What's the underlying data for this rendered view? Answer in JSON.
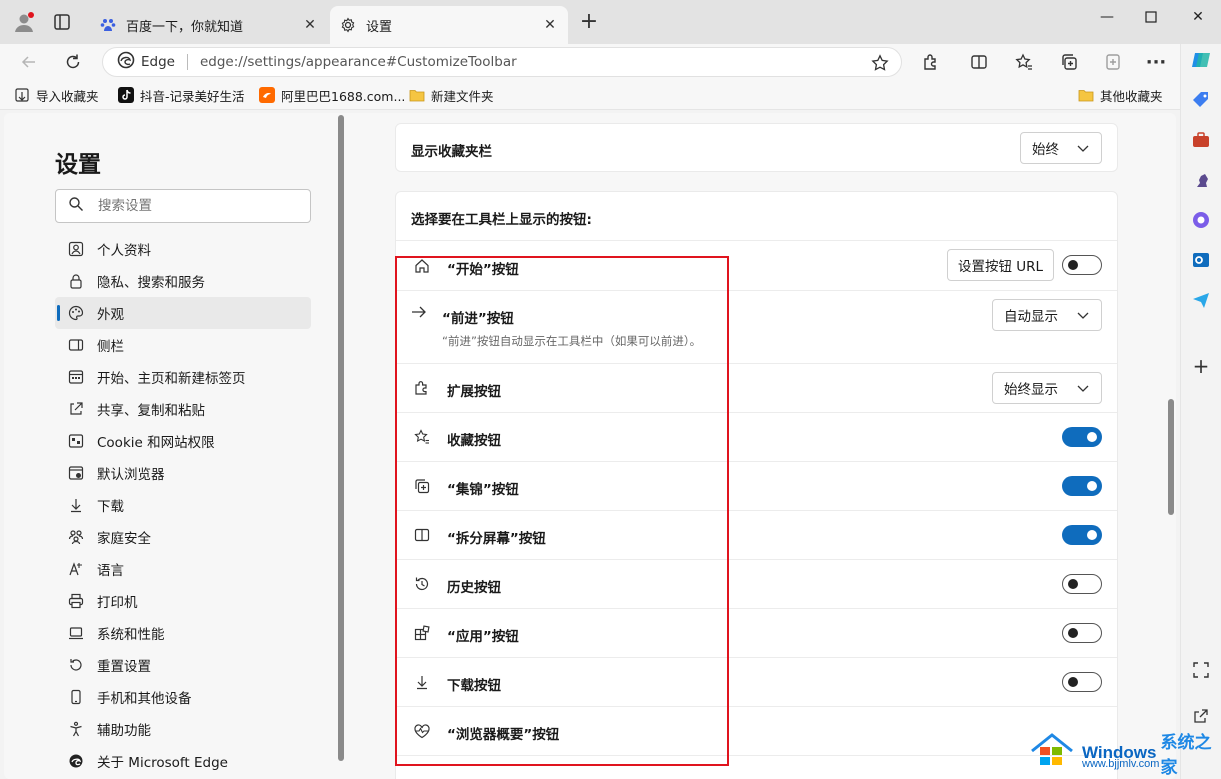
{
  "window": {
    "tabs": [
      {
        "title": "百度一下，你就知道",
        "favicon": "baidu-paw-icon"
      },
      {
        "title": "设置",
        "favicon": "gear-icon"
      }
    ]
  },
  "address": {
    "edge_label": "Edge",
    "url": "edge://settings/appearance#CustomizeToolbar"
  },
  "bookmarks": {
    "items": [
      "导入收藏夹",
      "抖音-记录美好生活",
      "阿里巴巴1688.com...",
      "新建文件夹"
    ],
    "other": "其他收藏夹"
  },
  "nav": {
    "title": "设置",
    "search_placeholder": "搜索设置",
    "items": [
      {
        "label": "个人资料",
        "icon": "profile-icon"
      },
      {
        "label": "隐私、搜索和服务",
        "icon": "lock-icon"
      },
      {
        "label": "外观",
        "icon": "palette-icon",
        "active": true
      },
      {
        "label": "侧栏",
        "icon": "sidebar-icon"
      },
      {
        "label": "开始、主页和新建标签页",
        "icon": "home-grid-icon"
      },
      {
        "label": "共享、复制和粘贴",
        "icon": "share-icon"
      },
      {
        "label": "Cookie 和网站权限",
        "icon": "cookie-icon"
      },
      {
        "label": "默认浏览器",
        "icon": "browser-icon"
      },
      {
        "label": "下载",
        "icon": "download-icon"
      },
      {
        "label": "家庭安全",
        "icon": "family-icon"
      },
      {
        "label": "语言",
        "icon": "language-icon"
      },
      {
        "label": "打印机",
        "icon": "printer-icon"
      },
      {
        "label": "系统和性能",
        "icon": "laptop-icon"
      },
      {
        "label": "重置设置",
        "icon": "reset-icon"
      },
      {
        "label": "手机和其他设备",
        "icon": "phone-icon"
      },
      {
        "label": "辅助功能",
        "icon": "accessibility-icon"
      },
      {
        "label": "关于 Microsoft Edge",
        "icon": "edge-icon"
      }
    ]
  },
  "main": {
    "favorites_bar": {
      "label": "显示收藏夹栏",
      "value": "始终"
    },
    "toolbar_section": {
      "title": "选择要在工具栏上显示的按钮:",
      "rows": [
        {
          "label": "“开始”按钮",
          "icon": "home-icon",
          "control": "url-button+toggle",
          "button_label": "设置按钮 URL",
          "enabled": false
        },
        {
          "label": "“前进”按钮",
          "icon": "forward-arrow-icon",
          "control": "dropdown",
          "value": "自动显示",
          "description": "“前进”按钮自动显示在工具栏中（如果可以前进）。"
        },
        {
          "label": "扩展按钮",
          "icon": "puzzle-icon",
          "control": "dropdown",
          "value": "始终显示"
        },
        {
          "label": "收藏按钮",
          "icon": "favorites-star-icon",
          "control": "toggle",
          "enabled": true
        },
        {
          "label": "“集锦”按钮",
          "icon": "collections-icon",
          "control": "toggle",
          "enabled": true
        },
        {
          "label": "“拆分屏幕”按钮",
          "icon": "split-screen-icon",
          "control": "toggle",
          "enabled": true
        },
        {
          "label": "历史按钮",
          "icon": "history-icon",
          "control": "toggle",
          "enabled": false
        },
        {
          "label": "“应用”按钮",
          "icon": "apps-icon",
          "control": "toggle",
          "enabled": false
        },
        {
          "label": "下载按钮",
          "icon": "download-icon",
          "control": "toggle",
          "enabled": false
        },
        {
          "label": "“浏览器概要”按钮",
          "icon": "heartbeat-icon",
          "control": "toggle",
          "enabled": false
        }
      ]
    }
  },
  "watermark": {
    "brand": "Windows",
    "brand_cn": "系统之家",
    "site": "www.bjjmlv.com"
  },
  "colors": {
    "accent": "#0f6cbd",
    "highlight": "#e0141e"
  }
}
